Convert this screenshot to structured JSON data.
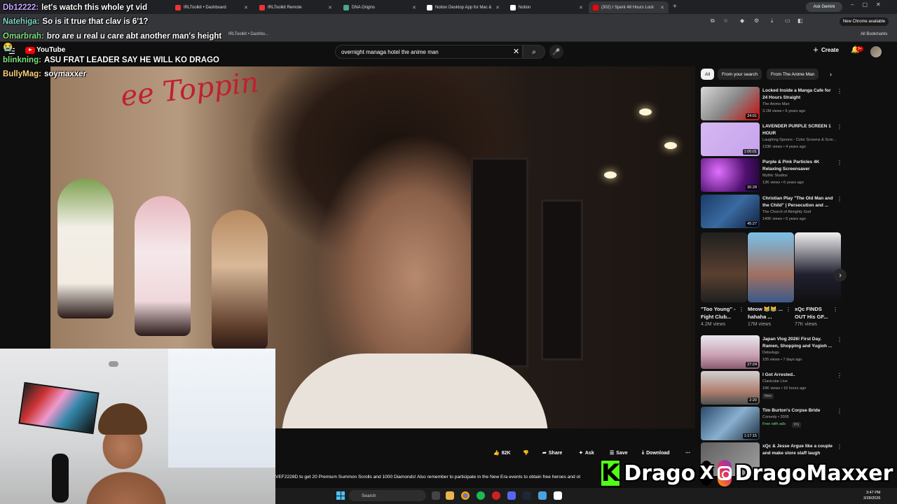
{
  "browser": {
    "tabs": [
      {
        "label": "IRLToolkit • Dashboard",
        "color": "#e33"
      },
      {
        "label": "IRLToolkit Remote",
        "color": "#e33"
      },
      {
        "label": "DNA Origins",
        "color": "#4a8"
      },
      {
        "label": "Notion Desktop App for Mac &",
        "color": "#fff"
      },
      {
        "label": "Notion",
        "color": "#fff"
      },
      {
        "label": "(302) I Spent 48 Hours Lock",
        "color": "#f00"
      }
    ],
    "new_tab": "+",
    "ask_gemini": "Ask Gemini",
    "new_chrome": "New Chrome available",
    "bookmark_item": "IRLToolkit • Dashbo...",
    "all_bookmarks": "All Bookmarks"
  },
  "chat": [
    {
      "user": "Db12222:",
      "message": "let's watch this whole yt vid",
      "color": "#c8a8ff"
    },
    {
      "user": "Natehiga:",
      "message": "So is it true that clav is 6'1?",
      "color": "#7fd6c8"
    },
    {
      "user": "Omarbrah:",
      "message": "bro are u real u care abt another man's height 😭",
      "color": "#7fe07f"
    },
    {
      "user": "blinkning:",
      "message": "ASU FRAT LEADER SAY HE WILL KO DRAGO",
      "color": "#7fe07f"
    },
    {
      "user": "BullyMag:",
      "message": "soymaxxer",
      "color": "#ffd27f"
    }
  ],
  "youtube": {
    "logo": "YouTube",
    "search_value": "overnight managa hotel the anime man",
    "create": "Create",
    "notif_count": "9+",
    "actions": {
      "likes": "82K",
      "share": "Share",
      "ask": "Ask",
      "save": "Save",
      "download": "Download"
    },
    "ticker": "VEF2228D to get 20 Premium Summon Scrolls and 1000 Diamonds! Also remember to participate in the New Era events to obtain free heroes and ot"
  },
  "sidebar": {
    "chips": [
      "All",
      "From your search",
      "From The Anime Man"
    ],
    "videos_top": [
      {
        "title": "Locked Inside a Manga Cafe for 24 Hours Straight",
        "channel": "The Anime Man",
        "meta": "3.1M views • 6 years ago",
        "duration": "24:01",
        "thumb": "linear-gradient(135deg,#d8d8d8,#888 50%,#b22 90%)"
      },
      {
        "title": "LAVENDER PURPLE SCREEN 1 HOUR",
        "channel": "Laughing Spoons - Color Screens & Scre...",
        "meta": "133K views • 4 years ago",
        "duration": "1:00:01",
        "thumb": "linear-gradient(135deg,#d6b8f0,#c6a2ee)"
      },
      {
        "title": "Purple & Pink Particles 4K Relaxing Screensaver",
        "channel": "Mythic Studios",
        "meta": "13K views • 6 years ago",
        "duration": "30:28",
        "thumb": "radial-gradient(circle at 30% 40%,#e070ff,#501070 60%,#1a0630)"
      },
      {
        "title": "Christian Play \"The Old Man and the Child\" | Persecution and ...",
        "channel": "The Church of Almighty God",
        "meta": "140K views • 5 years ago",
        "duration": "45:27",
        "thumb": "linear-gradient(135deg,#1a3a6a,#3a6aa0 50%,#102040)"
      }
    ],
    "shorts": [
      {
        "title": "\"Too Young\" - Fight Club...",
        "views": "4.2M views",
        "thumb": "linear-gradient(180deg,#202020,#5a4030 60%,#202020)"
      },
      {
        "title": "Meow 😹😹 ... hahaha ...",
        "views": "17M views",
        "thumb": "linear-gradient(180deg,#7ac0e8,#a07060 60%,#3a5a8a)"
      },
      {
        "title": "xQc FINDS OUT His GF...",
        "views": "77K views",
        "thumb": "linear-gradient(180deg,#f0f0f0,#202030 60%,#101010)"
      }
    ],
    "videos_bottom": [
      {
        "title": "Japan Vlog 2026! First Day. Ramen, Shopping and Yugioh ...",
        "channel": "Delsvlogs",
        "meta": "105 views • 7 days ago",
        "duration": "27:24",
        "thumb": "linear-gradient(180deg,#e8e8f0,#c8a0b0 60%,#8a5a70)"
      },
      {
        "title": "I Got Arrested..",
        "channel": "Clavicular Live",
        "meta": "19K views • 16 hours ago",
        "duration": "2:20",
        "badge": "New",
        "thumb": "linear-gradient(180deg,#d0d0d0,#b08070 60%,#505050)"
      },
      {
        "title": "Tim Burton's Corpse Bride",
        "channel": "Comedy • 2005",
        "meta": "Free with ads",
        "badge": "PG",
        "duration": "1:17:15",
        "thumb": "linear-gradient(135deg,#2a4a6a,#8ab0d0 50%,#1a2a3a)"
      },
      {
        "title": "xQc & Jesse Argue like a couple and make store staff laugh",
        "channel": "",
        "meta": "",
        "duration": "",
        "thumb": "linear-gradient(135deg,#606060,#a0a0a0)"
      }
    ]
  },
  "branding": {
    "kick": "K",
    "kick_name": "Drago",
    "x": "X",
    "ig_name": "DragoMaxxer"
  },
  "taskbar": {
    "search": "Search",
    "time": "3:47 PM",
    "date": "3/28/2026"
  }
}
